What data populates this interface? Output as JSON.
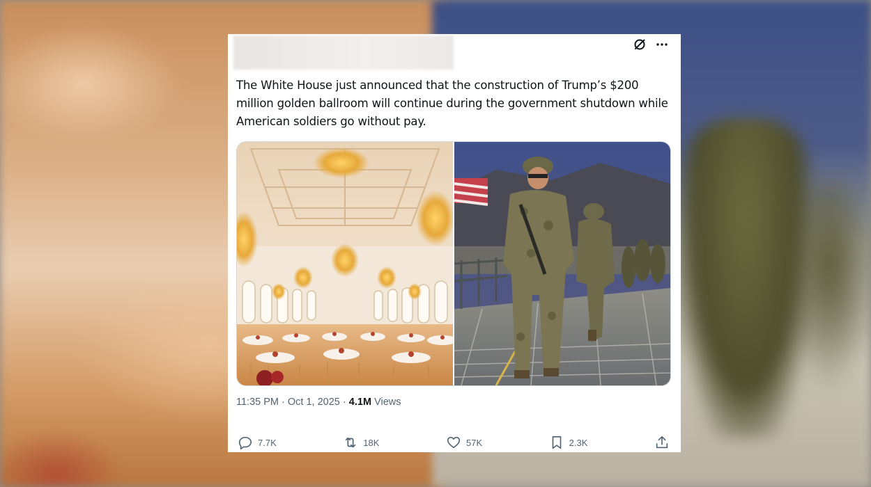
{
  "tweet": {
    "text": "The White House just announced that the construction of Trump’s $200 million golden ballroom will continue during the government shutdown while American soldiers go without pay.",
    "time": "11:35 PM",
    "separator1": "·",
    "date": "Oct 1, 2025",
    "separator2": "·",
    "views_count": "4.1M",
    "views_label": "Views",
    "icons": {
      "grok": "grok-icon",
      "more": "more-options-icon"
    },
    "media": [
      {
        "subject": "golden ballroom"
      },
      {
        "subject": "soldiers marching"
      }
    ],
    "actions": {
      "replies": "7.7K",
      "reposts": "18K",
      "likes": "57K",
      "bookmarks": "2.3K"
    }
  },
  "colors": {
    "text": "#0f1419",
    "secondary_text": "#536471",
    "background": "#ffffff"
  }
}
